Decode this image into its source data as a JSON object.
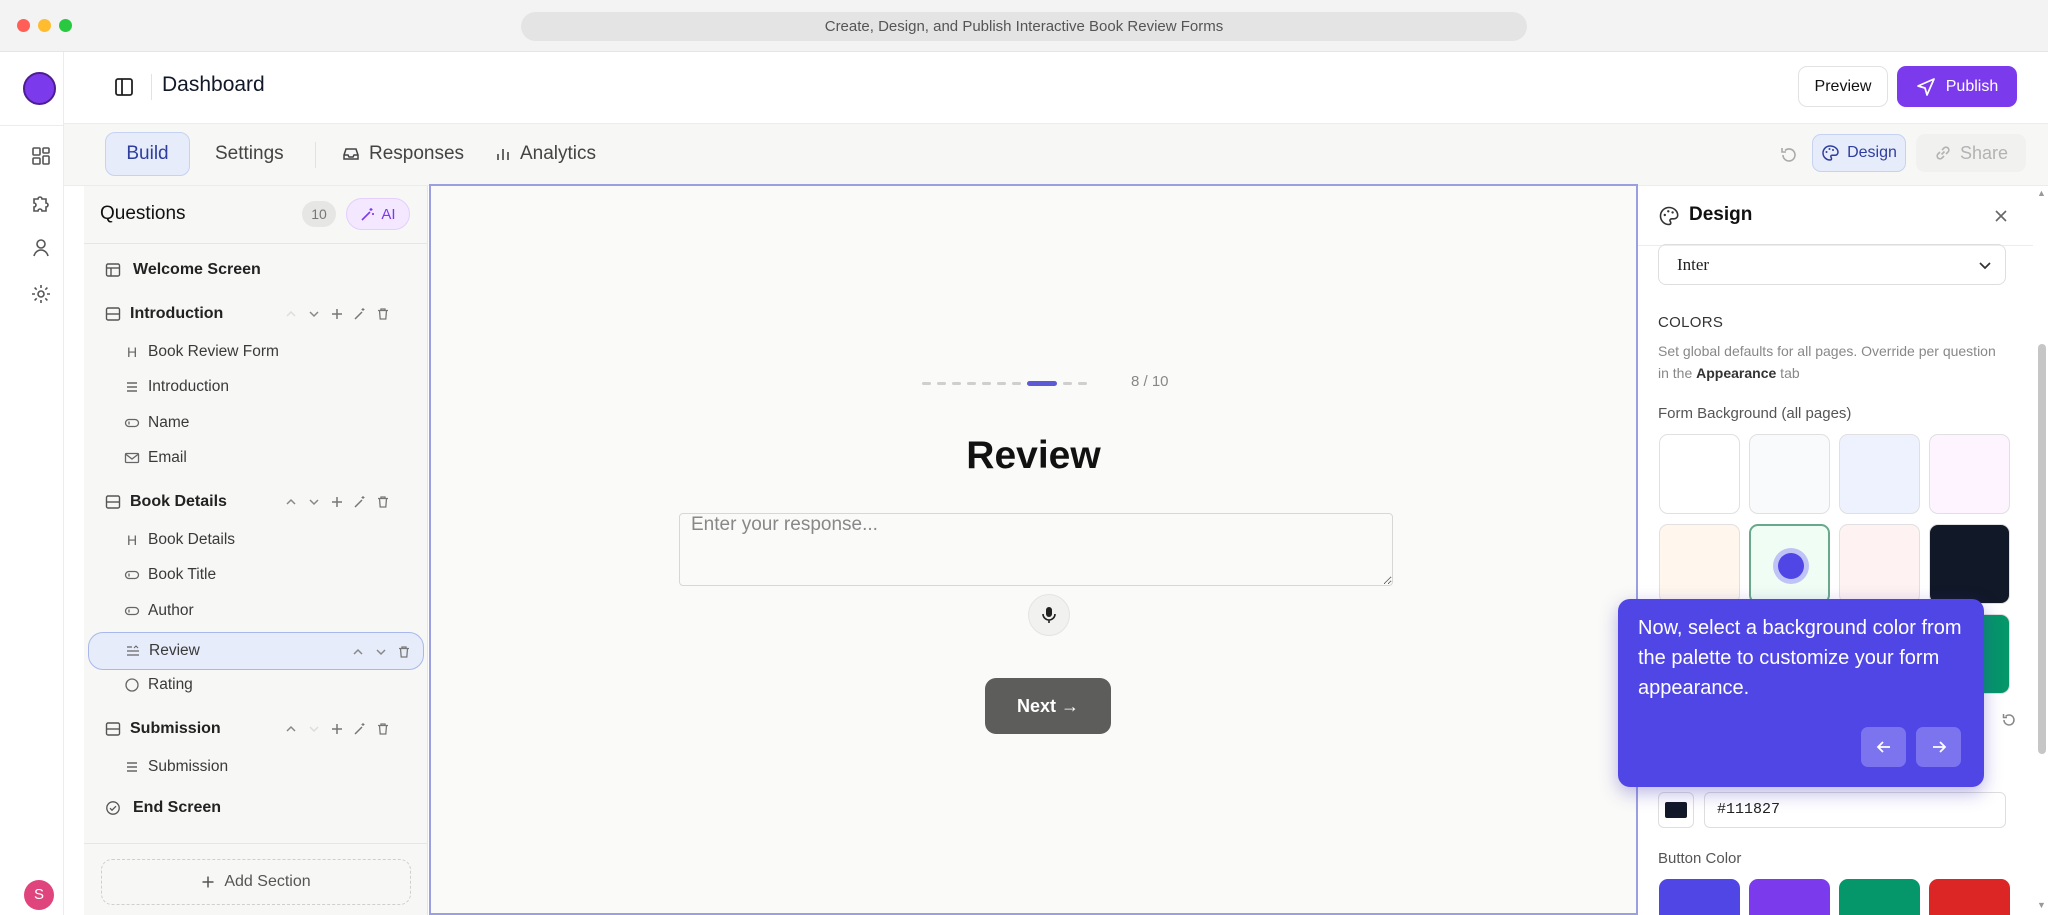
{
  "window": {
    "title": "Create, Design, and Publish Interactive Book Review Forms"
  },
  "rail": {
    "avatar_letter": "S"
  },
  "header": {
    "title": "Dashboard",
    "preview_label": "Preview",
    "publish_label": "Publish"
  },
  "tabs": {
    "build": "Build",
    "settings": "Settings",
    "responses": "Responses",
    "analytics": "Analytics",
    "design": "Design",
    "share": "Share"
  },
  "questions": {
    "title": "Questions",
    "count": "10",
    "ai_label": "AI",
    "welcome": "Welcome Screen",
    "sections": [
      {
        "title": "Introduction",
        "items": [
          "Book Review Form",
          "Introduction",
          "Name",
          "Email"
        ]
      },
      {
        "title": "Book Details",
        "items": [
          "Book Details",
          "Book Title",
          "Author",
          "Review",
          "Rating"
        ]
      },
      {
        "title": "Submission",
        "items": [
          "Submission"
        ]
      }
    ],
    "end": "End Screen",
    "add_section": "Add Section"
  },
  "canvas": {
    "progress_label": "8 / 10",
    "progress_total": 10,
    "progress_current": 8,
    "heading": "Review",
    "input_placeholder": "Enter your response...",
    "next_label": "Next →"
  },
  "design": {
    "title": "Design",
    "font_value": "Inter",
    "colors_title": "COLORS",
    "colors_desc_pre": "Set global defaults for all pages. Override per question in the ",
    "colors_desc_bold": "Appearance",
    "colors_desc_post": " tab",
    "form_bg_label": "Form Background (all pages)",
    "form_bg_swatches": [
      "#ffffff",
      "#f8fafc",
      "#eef2ff",
      "#fdf4ff",
      "#fff7ed",
      "#f0fdf4",
      "#fef2f2",
      "#111827",
      "#eeeeee",
      "#e5e5e5",
      "#e0e0e0",
      "#059669"
    ],
    "selected_swatch": "#f0fdf4",
    "hex_value": "#111827",
    "button_color_label": "Button Color",
    "button_swatches": [
      "#4f46e5",
      "#7c3aed",
      "#059669",
      "#dc2626"
    ]
  },
  "tooltip": {
    "text": "Now, select a background color from the palette to customize your form appearance."
  },
  "colors": {
    "accent": "#7c3aed",
    "indigo": "#4f46e5"
  }
}
